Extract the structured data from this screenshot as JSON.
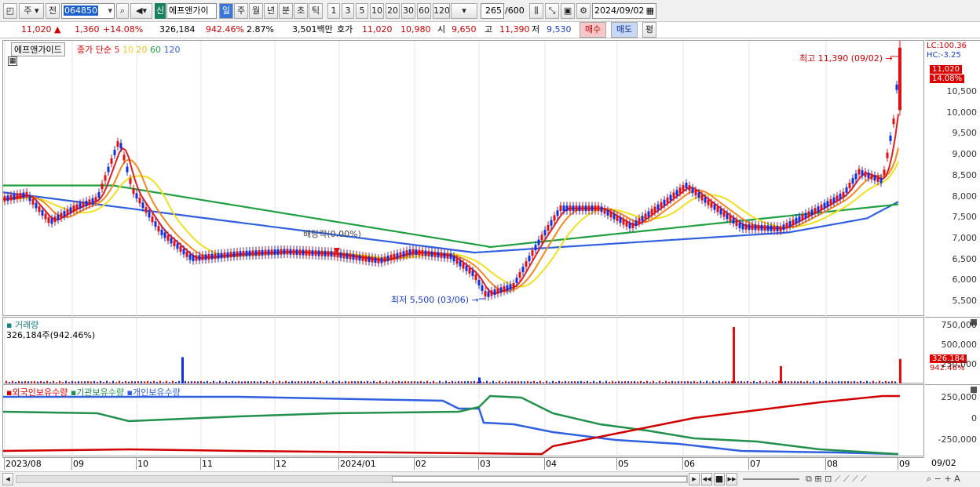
{
  "toolbar": {
    "market": "주",
    "scope": "전",
    "code": "064850",
    "new_badge": "신",
    "stock_name": "에프앤가이",
    "periods": [
      "일",
      "주",
      "월",
      "년",
      "분",
      "초",
      "틱"
    ],
    "active_period": "일",
    "intervals": [
      "1",
      "3",
      "5",
      "10",
      "20",
      "30",
      "60",
      "120"
    ],
    "count": "265",
    "total": "/600",
    "date": "2024/09/02"
  },
  "quote": {
    "price": "11,020",
    "arrow": "▲",
    "change": "1,360",
    "change_pct": "+14.08%",
    "volume": "326,184",
    "vol_ratio": "942.46%",
    "turnover": "2.87%",
    "amount": "3,501백만",
    "ask_label": "호가",
    "ask": "11,020",
    "bid": "10,980",
    "open_label": "시",
    "open": "9,650",
    "high_label": "고",
    "high": "11,390",
    "low_label": "저",
    "low": "9,530",
    "buy_button": "매수",
    "sell_button": "매도",
    "eval_button": "평"
  },
  "price_panel": {
    "title": "에프앤가이드",
    "ma_label": "종가 단순",
    "ma_periods": [
      "5",
      "10",
      "20",
      "60",
      "120"
    ],
    "lc": "LC:100.36",
    "hc": "HC:-3.25",
    "last_price": "11,020",
    "last_pct": "14.08%",
    "high_note": "최고 11,390 (09/02)",
    "low_note": "최저 5,500 (03/06)",
    "dividend_note": "배당락(0.00%)",
    "y_ticks": [
      "10,500",
      "10,000",
      "9,500",
      "9,000",
      "8,500",
      "8,000",
      "7,500",
      "7,000",
      "6,500",
      "6,000",
      "5,500"
    ]
  },
  "volume_panel": {
    "title": "거래량",
    "current": "326,184주(942.46%)",
    "last_volume": "326,184",
    "last_pct": "942.46%",
    "y_ticks": [
      "750,000",
      "500,000",
      "250,000"
    ]
  },
  "holding_panel": {
    "series": [
      "외국인보유수량",
      "기관보유수량",
      "개인보유수량"
    ],
    "y_ticks": [
      "250,000",
      "0",
      "-250,000"
    ]
  },
  "x_axis": [
    "2023/08",
    "09",
    "10",
    "11",
    "12",
    "2024/01",
    "02",
    "03",
    "04",
    "05",
    "06",
    "07",
    "08",
    "09"
  ],
  "x_axis_end": "09/02",
  "colors": {
    "ma5": "#e02020",
    "ma10": "#f08a20",
    "ma20": "#f0e020",
    "ma60": "#20a040",
    "ma120": "#3060e0",
    "up": "#e01010",
    "down": "#1030e0"
  },
  "chart_data": {
    "type": "candlestick",
    "ma_series": [
      {
        "name": "5",
        "values": [
          7800,
          7750,
          7600,
          7200,
          7300,
          7600,
          8700,
          8100,
          7400,
          6800,
          6500,
          6400,
          6450,
          6500,
          6480,
          6450,
          6350,
          6500,
          6550,
          6500,
          6100,
          5700,
          6300,
          7200,
          7500,
          7450,
          7200,
          7500,
          7900,
          7700,
          7000,
          7000,
          7400,
          7700,
          8200,
          8300,
          9300,
          11020
        ]
      },
      {
        "name": "120",
        "values": [
          7850,
          7850,
          7850,
          7850,
          7900,
          7950,
          7950,
          7900,
          7800,
          7650,
          7500,
          7350,
          7200,
          7050,
          6950,
          6850,
          6750,
          6650,
          6550,
          6450,
          6400,
          6500,
          6600,
          6700,
          6750,
          6800,
          6850,
          6850,
          6900,
          6950,
          7000,
          7050,
          7100,
          7150,
          7200,
          7300,
          7450
        ]
      }
    ],
    "volume_peak": 750000,
    "high": 11390,
    "low": 5500
  }
}
